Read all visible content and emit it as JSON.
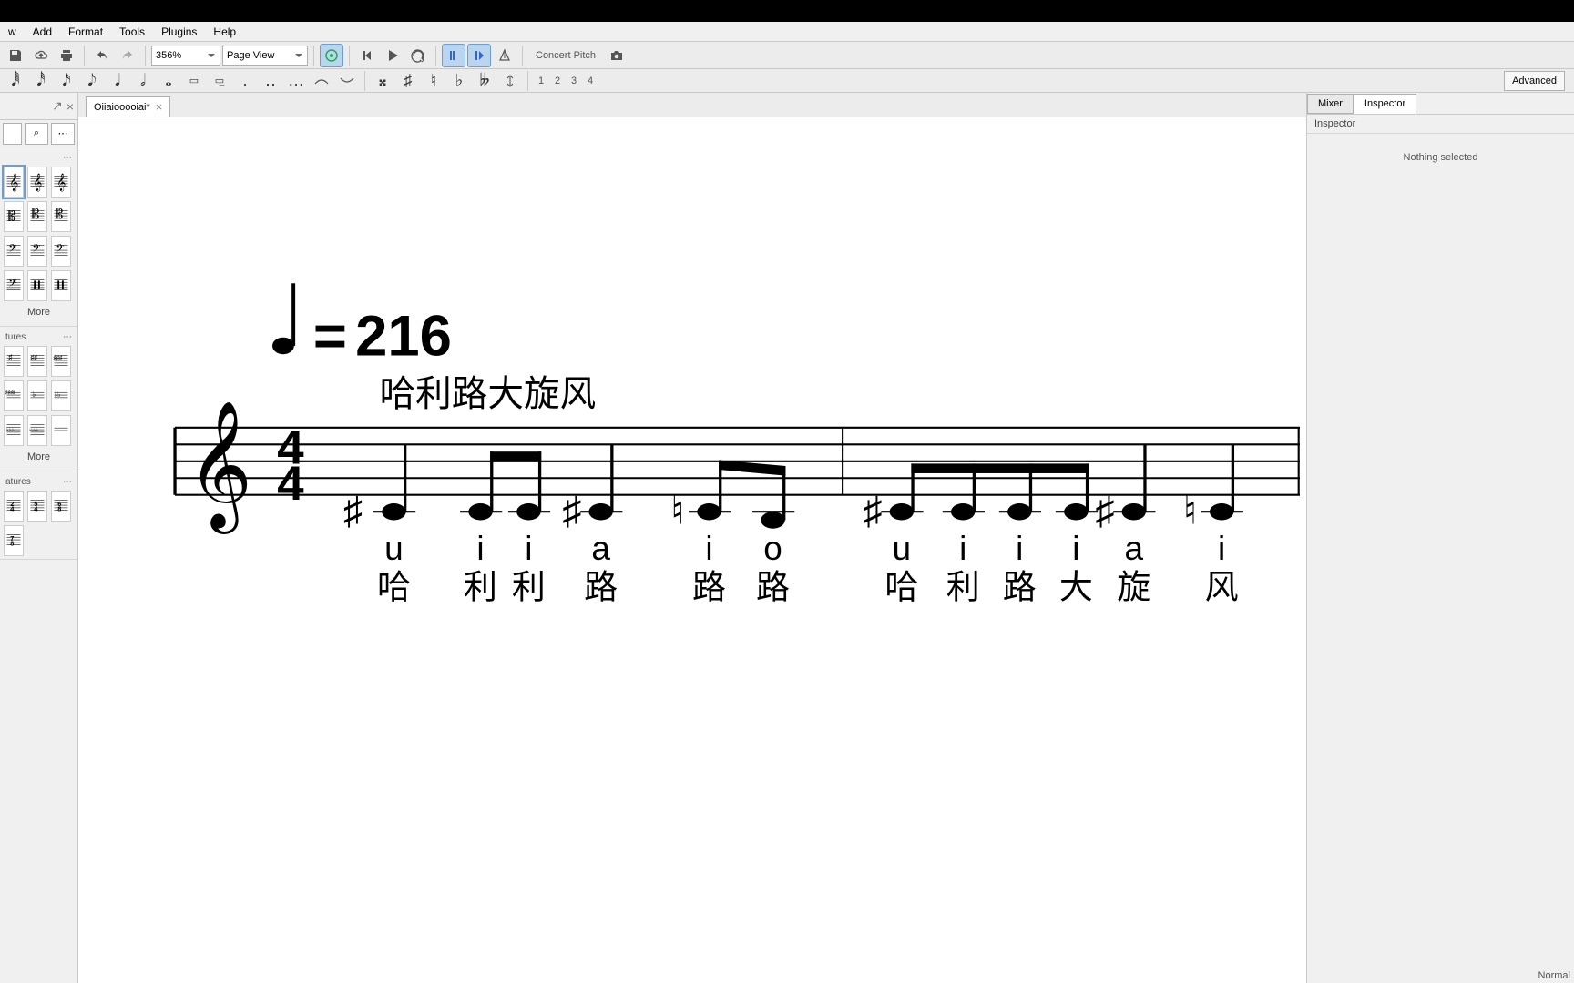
{
  "menu": {
    "items": [
      "w",
      "Add",
      "Format",
      "Tools",
      "Plugins",
      "Help"
    ]
  },
  "toolbar": {
    "zoom": "356%",
    "view_mode": "Page View",
    "concert_pitch": "Concert Pitch"
  },
  "toolbar2": {
    "voices": [
      "1",
      "2",
      "3",
      "4"
    ],
    "advanced": "Advanced"
  },
  "palette": {
    "popout_hint": "↗",
    "close_hint": "×",
    "search_icon": "⌕",
    "menu_icon": "⋯",
    "section1_hdr": "",
    "section1_menu": "⋯",
    "section1_more": "More",
    "section2_hdr": "tures",
    "section2_menu": "⋯",
    "section2_more": "More",
    "section3_hdr": "atures",
    "section3_menu": "⋯"
  },
  "document": {
    "tab_label": "Oiiaiooooiai*",
    "tab_close": "×"
  },
  "score": {
    "tempo_bpm": "216",
    "tempo_equals": "=",
    "instrument_name": "哈利路大旋风",
    "time_sig_num": "4",
    "time_sig_den": "4",
    "lyrics1": [
      "u",
      "i",
      "i",
      "a",
      "i",
      "o",
      "u",
      "i",
      "i",
      "i",
      "a",
      "i"
    ],
    "lyrics2": [
      "哈",
      "利",
      "利",
      "路",
      "路",
      "路",
      "哈",
      "利",
      "路",
      "大",
      "旋",
      "风"
    ]
  },
  "inspector": {
    "tab_mixer": "Mixer",
    "tab_inspector": "Inspector",
    "header": "Inspector",
    "body": "Nothing selected"
  },
  "status_text": "Normal"
}
